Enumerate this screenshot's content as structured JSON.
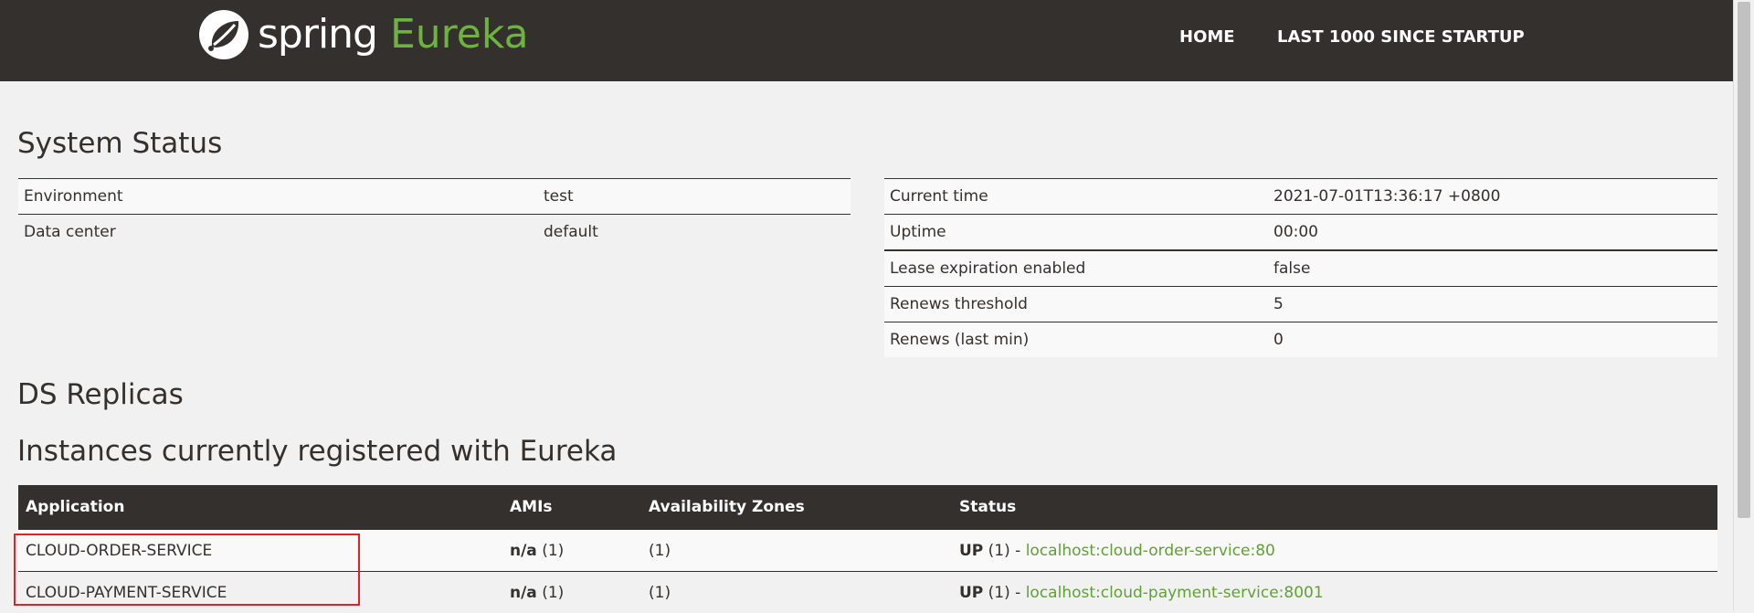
{
  "header": {
    "logo_spring": "spring",
    "logo_eureka": "Eureka",
    "nav": [
      {
        "label": "HOME"
      },
      {
        "label": "LAST 1000 SINCE STARTUP"
      }
    ]
  },
  "system_status": {
    "title": "System Status",
    "left": [
      {
        "key": "Environment",
        "value": "test"
      },
      {
        "key": "Data center",
        "value": "default"
      }
    ],
    "right": [
      {
        "key": "Current time",
        "value": "2021-07-01T13:36:17 +0800"
      },
      {
        "key": "Uptime",
        "value": "00:00"
      },
      {
        "key": "Lease expiration enabled",
        "value": "false"
      },
      {
        "key": "Renews threshold",
        "value": "5"
      },
      {
        "key": "Renews (last min)",
        "value": "0"
      }
    ]
  },
  "ds_replicas": {
    "title": "DS Replicas"
  },
  "instances": {
    "title": "Instances currently registered with Eureka",
    "columns": [
      "Application",
      "AMIs",
      "Availability Zones",
      "Status"
    ],
    "rows": [
      {
        "application": "CLOUD-ORDER-SERVICE",
        "amis_bold": "n/a",
        "amis_count": " (1)",
        "zones": "(1)",
        "status_bold": "UP",
        "status_count": " (1) - ",
        "status_link": "localhost:cloud-order-service:80"
      },
      {
        "application": "CLOUD-PAYMENT-SERVICE",
        "amis_bold": "n/a",
        "amis_count": " (1)",
        "zones": "(1)",
        "status_bold": "UP",
        "status_count": " (1) - ",
        "status_link": "localhost:cloud-payment-service:8001"
      }
    ]
  },
  "colors": {
    "navbar": "#34302d",
    "accent_green": "#6db33f",
    "highlight_red": "#e0212a"
  }
}
